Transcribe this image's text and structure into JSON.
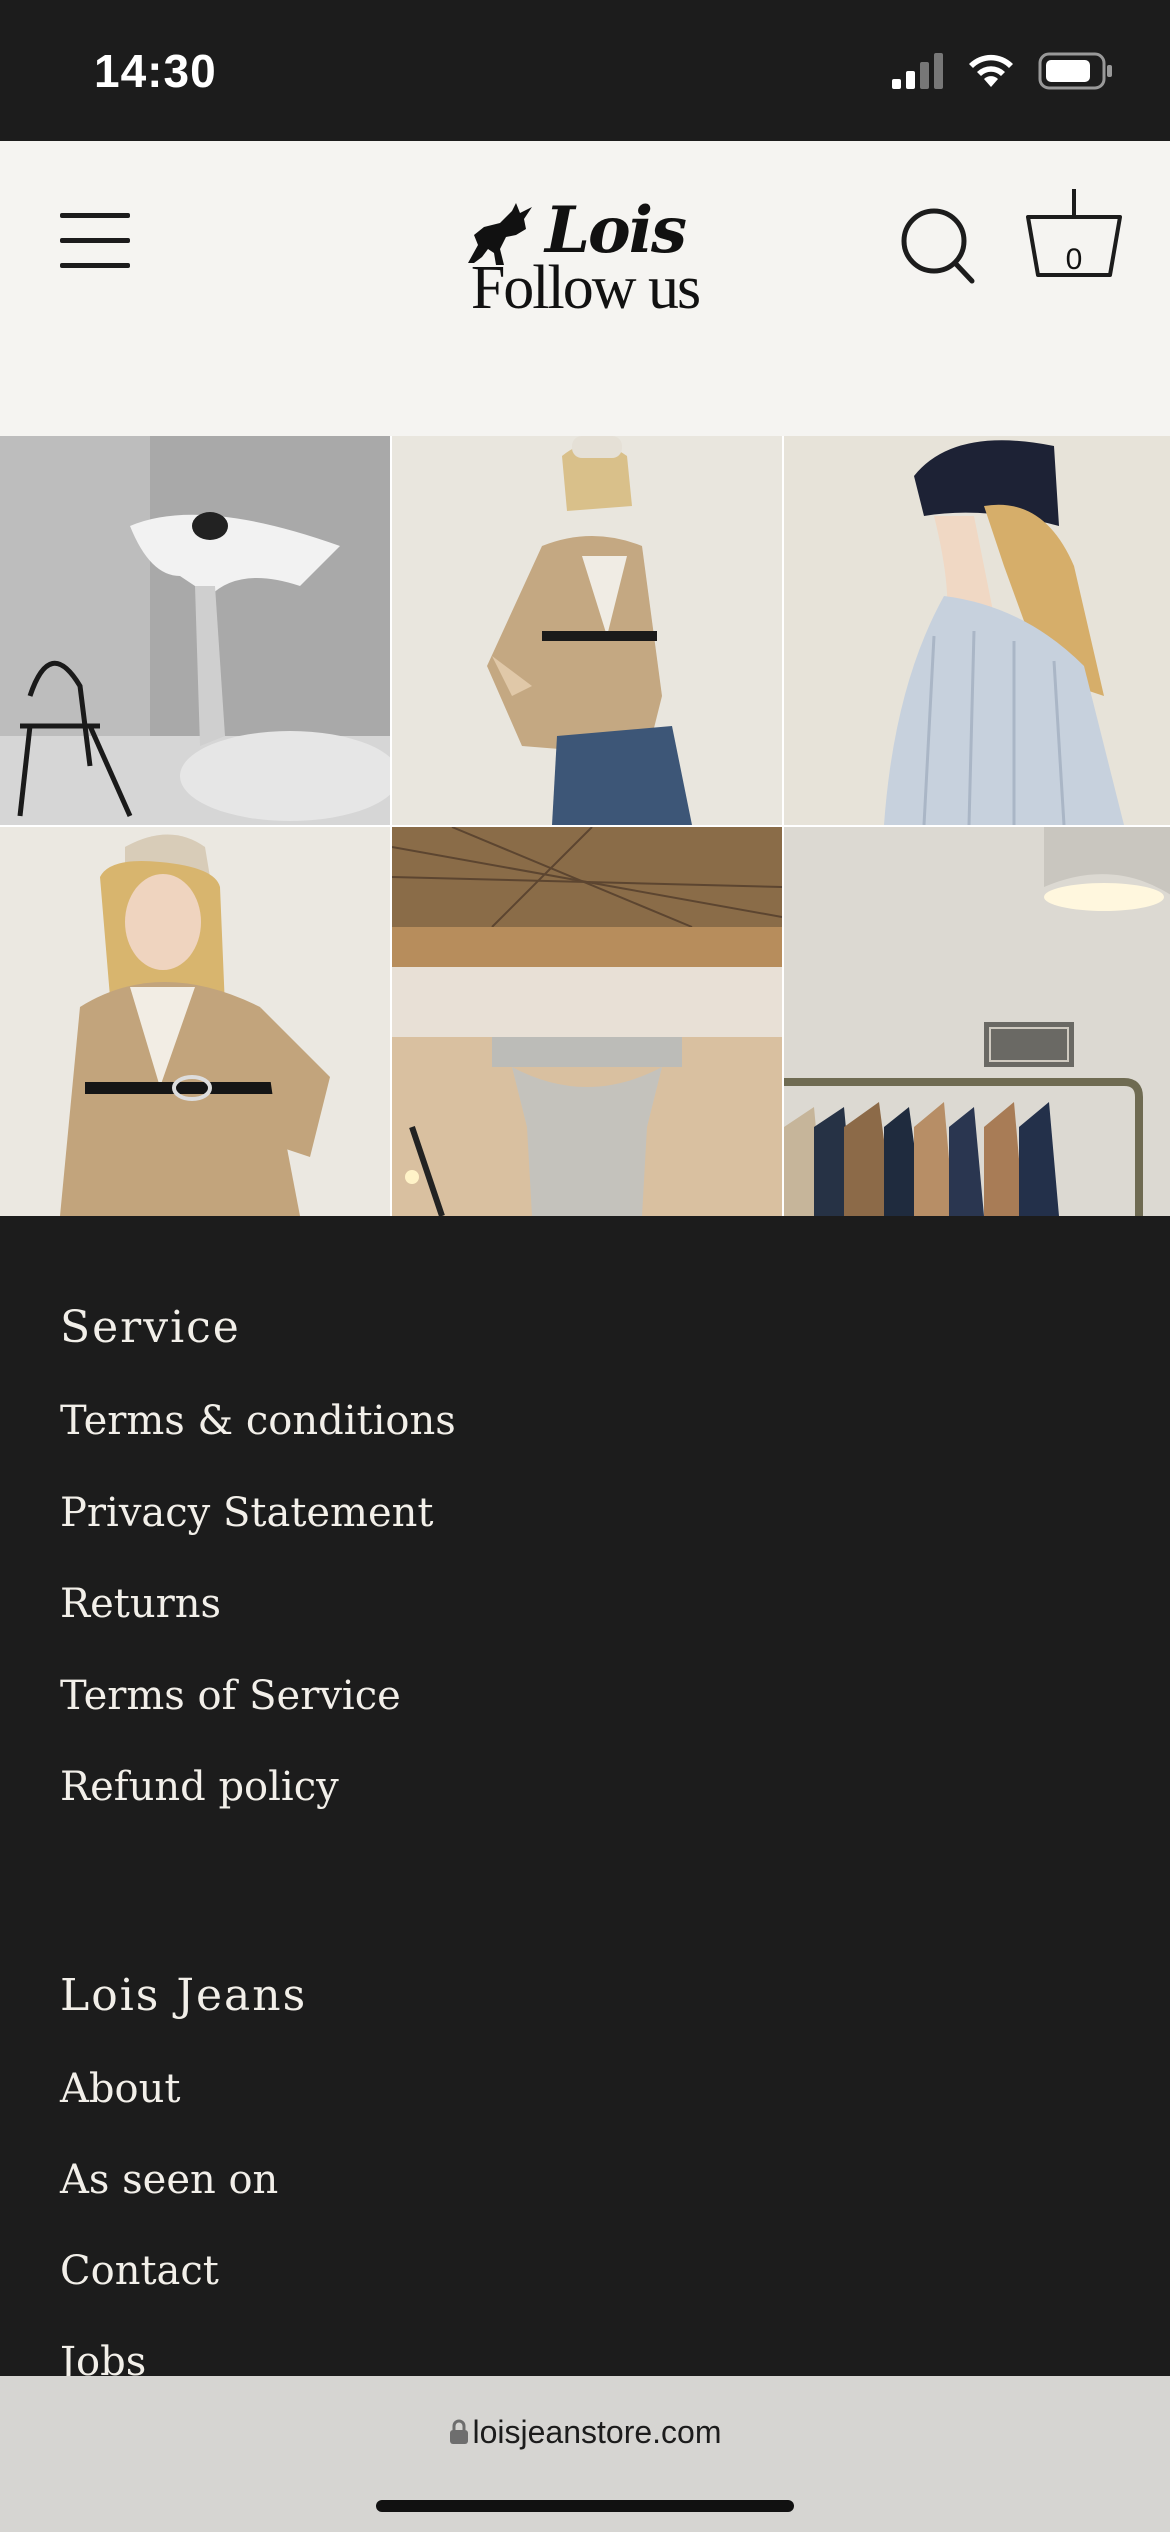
{
  "status_bar": {
    "time": "14:30"
  },
  "header": {
    "logo_word": "Lois",
    "logo_subtitle": "Follow us",
    "cart_count": "0"
  },
  "gallery": {
    "tiles": [
      {
        "name": "bw-billowing-shirt-photo"
      },
      {
        "name": "camel-blazer-model-photo"
      },
      {
        "name": "striped-shirt-beanie-photo"
      },
      {
        "name": "belted-blazer-model-photo"
      },
      {
        "name": "column-interior-photo"
      },
      {
        "name": "clothing-rack-photo"
      }
    ]
  },
  "footer": {
    "service": {
      "heading": "Service",
      "links": [
        "Terms & conditions",
        "Privacy Statement",
        "Returns",
        "Terms of Service",
        "Refund policy"
      ]
    },
    "lois_jeans": {
      "heading": "Lois Jeans",
      "links": [
        "About",
        "As seen on",
        "Contact",
        "Jobs"
      ]
    }
  },
  "browser": {
    "url": "loisjeanstore.com"
  },
  "colors": {
    "dark": "#1c1c1c",
    "header_bg": "#f5f4f1",
    "footer_text": "#f2efe9",
    "url_bar": "#d6d5d2"
  }
}
